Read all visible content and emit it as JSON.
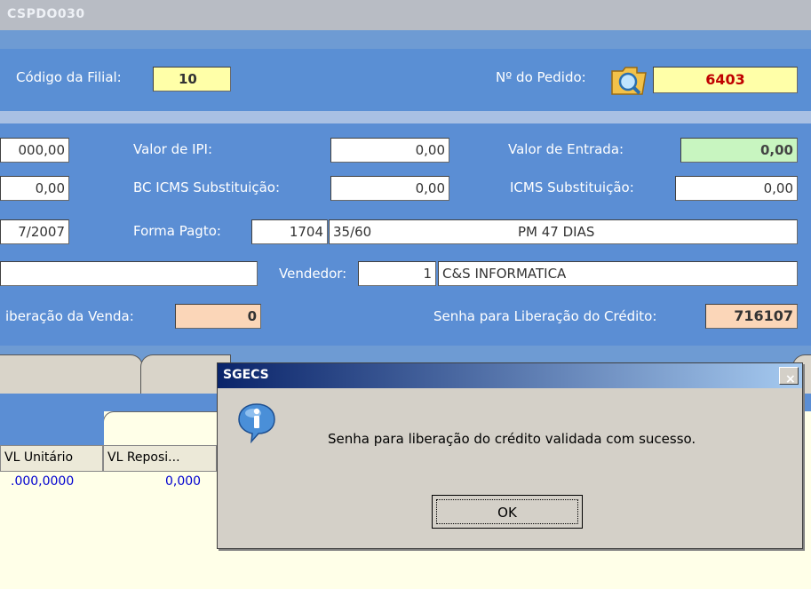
{
  "window": {
    "title": "CSPDO030"
  },
  "header": {
    "codigo_filial_label": "Código da Filial:",
    "codigo_filial_value": "10",
    "pedido_label": "Nº do Pedido:",
    "pedido_value": "6403"
  },
  "form": {
    "row1": {
      "left_value": "000,00",
      "ipi_label": "Valor de IPI:",
      "ipi_value": "0,00",
      "entrada_label": "Valor de Entrada:",
      "entrada_value": "0,00"
    },
    "row2": {
      "left_value": "0,00",
      "bc_label": "BC ICMS Substituição:",
      "bc_value": "0,00",
      "icms_label": "ICMS Substituição:",
      "icms_value": "0,00"
    },
    "row3": {
      "left_value": "7/2007",
      "forma_label": "Forma  Pagto:",
      "forma_code": "1704",
      "forma_desc": "35/60",
      "forma_name": "PM 47 DIAS"
    },
    "row4": {
      "vendedor_label": "Vendedor:",
      "vendedor_code": "1",
      "vendedor_name": "C&S INFORMATICA"
    },
    "row5": {
      "venda_label": "iberação da Venda:",
      "venda_value": "0",
      "credito_label": "Senha para Liberação do Crédito:",
      "credito_value": "716107"
    }
  },
  "grid": {
    "columns": [
      "VL Unitário",
      "VL Reposi..."
    ],
    "rows": [
      [
        ".000,0000",
        "0,000"
      ]
    ]
  },
  "dialog": {
    "title": "SGECS",
    "close_glyph": "×",
    "message": "Senha para liberação do crédito validada com sucesso.",
    "ok_label": "OK",
    "icon": "info-icon"
  },
  "colors": {
    "form_bg": "#5b8ed4",
    "dialog_title": "#0a246a",
    "order_value": "#c00000",
    "grid_text": "#0000d0"
  }
}
